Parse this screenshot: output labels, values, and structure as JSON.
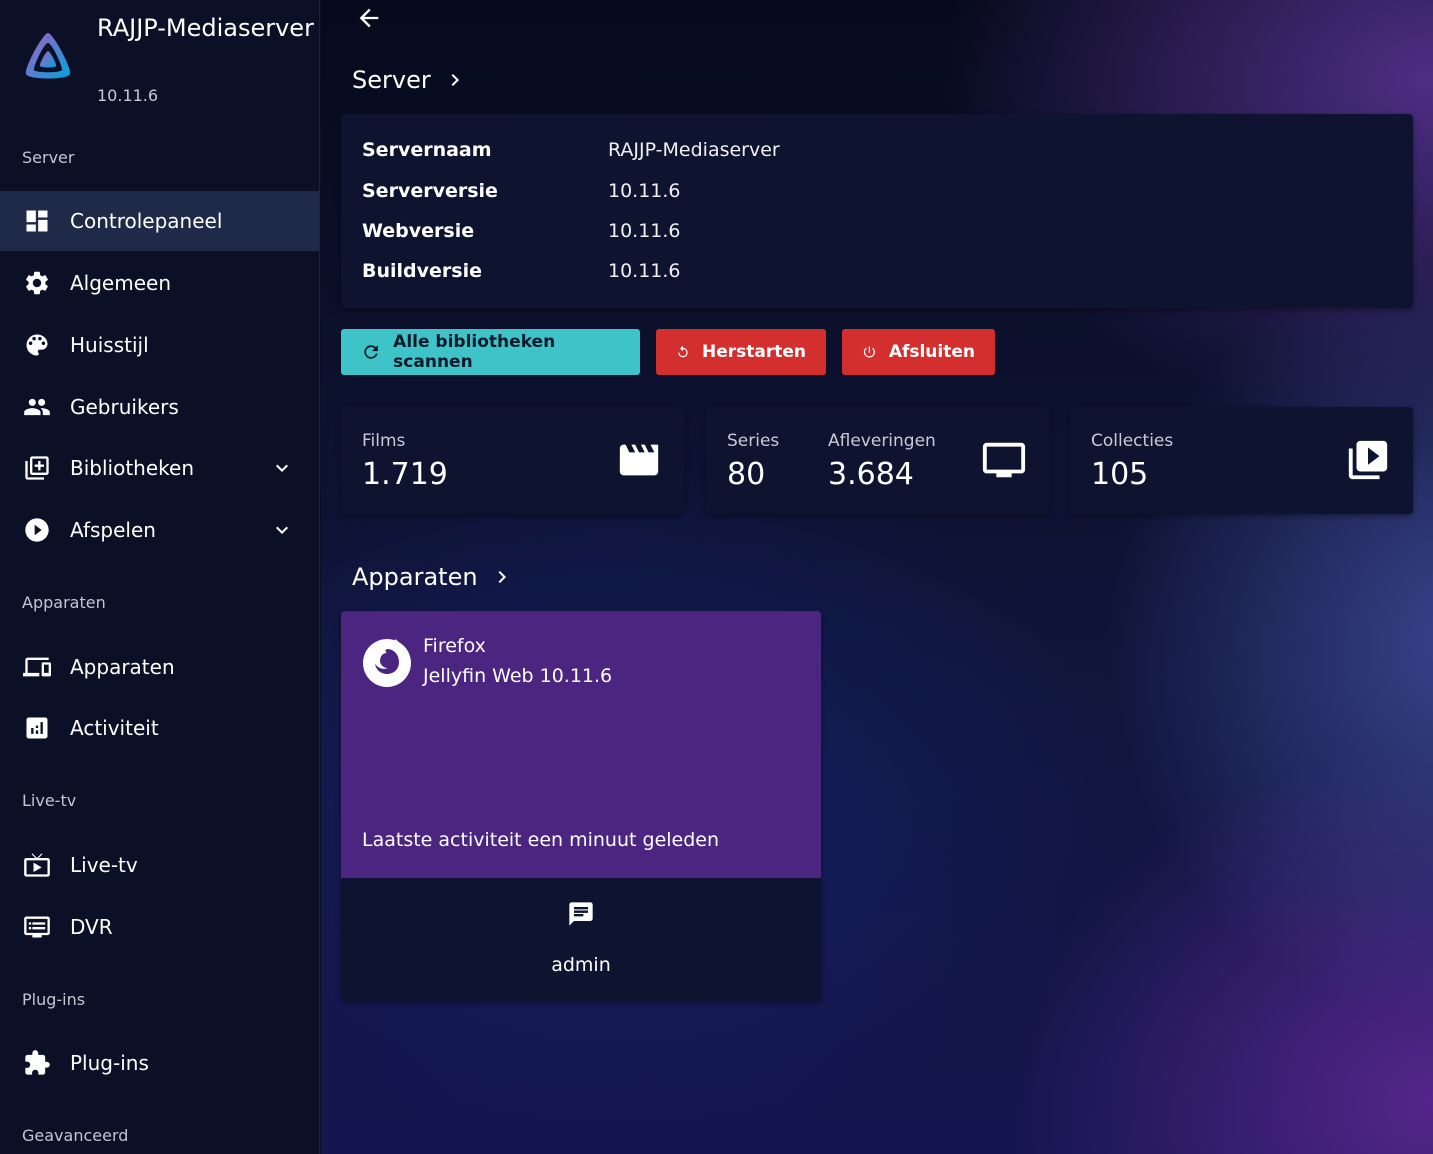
{
  "brand": {
    "name": "RAJJP-Mediaserver",
    "version": "10.11.6",
    "logo_icon": "jellyfin-logo-icon"
  },
  "sidebar": {
    "sections": [
      {
        "label": "Server"
      },
      {
        "label": "Apparaten"
      },
      {
        "label": "Live-tv"
      },
      {
        "label": "Plug-ins"
      },
      {
        "label": "Geavanceerd"
      }
    ],
    "items": [
      {
        "label": "Controlepaneel",
        "icon": "dashboard-icon",
        "active": true
      },
      {
        "label": "Algemeen",
        "icon": "settings-icon"
      },
      {
        "label": "Huisstijl",
        "icon": "palette-icon"
      },
      {
        "label": "Gebruikers",
        "icon": "people-icon"
      },
      {
        "label": "Bibliotheken",
        "icon": "library-add-icon",
        "expandable": true
      },
      {
        "label": "Afspelen",
        "icon": "play-circle-icon",
        "expandable": true
      },
      {
        "label": "Apparaten",
        "icon": "devices-icon"
      },
      {
        "label": "Activiteit",
        "icon": "analytics-icon"
      },
      {
        "label": "Live-tv",
        "icon": "live-tv-icon"
      },
      {
        "label": "DVR",
        "icon": "dvr-icon"
      },
      {
        "label": "Plug-ins",
        "icon": "extension-icon"
      }
    ]
  },
  "main": {
    "server_section": {
      "title": "Server"
    },
    "server_info": [
      {
        "key": "Servernaam",
        "value": "RAJJP-Mediaserver"
      },
      {
        "key": "Serverversie",
        "value": "10.11.6"
      },
      {
        "key": "Webversie",
        "value": "10.11.6"
      },
      {
        "key": "Buildversie",
        "value": "10.11.6"
      }
    ],
    "buttons": {
      "scan": "Alle bibliotheken scannen",
      "restart": "Herstarten",
      "shutdown": "Afsluiten"
    },
    "stats": {
      "films": {
        "label": "Films",
        "value": "1.719"
      },
      "series": {
        "label": "Series",
        "value": "80"
      },
      "episodes": {
        "label": "Afleveringen",
        "value": "3.684"
      },
      "collections": {
        "label": "Collecties",
        "value": "105"
      }
    },
    "devices_section": {
      "title": "Apparaten"
    },
    "device": {
      "name": "Firefox",
      "client": "Jellyfin Web 10.11.6",
      "activity": "Laatste activiteit een minuut geleden",
      "user": "admin"
    }
  },
  "colors": {
    "accent_scan": "#3ec3c8",
    "danger": "#d32f2f",
    "device_card": "#4b2580",
    "card_bg": "#0e1430",
    "sidebar_bg": "#0b1026",
    "active_item": "#1e2a48"
  }
}
